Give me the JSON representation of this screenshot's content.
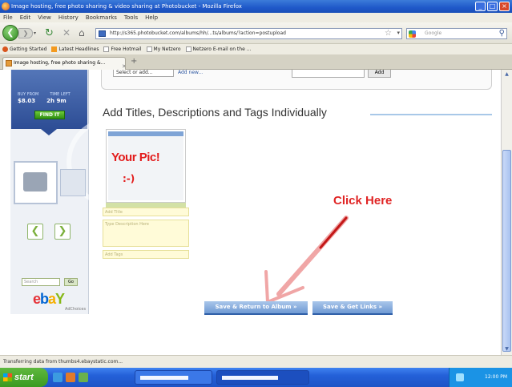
{
  "window": {
    "title": "Image hosting, free photo sharing & video sharing at Photobucket - Mozilla Firefox",
    "controls": {
      "minimize": "_",
      "maximize": "□",
      "close": "×"
    }
  },
  "menu": [
    "File",
    "Edit",
    "View",
    "History",
    "Bookmarks",
    "Tools",
    "Help"
  ],
  "nav": {
    "url": "http://s365.photobucket.com/albums/hh/...ts/albums/?action=postupload",
    "search_placeholder": "Google"
  },
  "bookmarks": [
    {
      "label": "Getting Started",
      "icon": "firefox-icon"
    },
    {
      "label": "Latest Headlines",
      "icon": "rss-icon"
    },
    {
      "label": "Free Hotmail",
      "icon": "page-icon"
    },
    {
      "label": "My Netzero",
      "icon": "page-icon"
    },
    {
      "label": "Netzero E-mail on the ...",
      "icon": "page-icon"
    }
  ],
  "tabs": [
    {
      "label": "Image hosting, free photo sharing &...",
      "active": true
    }
  ],
  "sidebar_ad": {
    "label_buy": "BUY FROM",
    "label_time": "TIME LEFT",
    "price": "$8.03",
    "time_left": "2h 9m",
    "find_it": "FIND IT",
    "search_placeholder": "Search",
    "go": "Go",
    "logo": {
      "e": "e",
      "b": "b",
      "a": "a",
      "y": "Y"
    },
    "adchoices": "AdChoices"
  },
  "form": {
    "event_select": "Select or add...",
    "add_new": "Add new...",
    "add_button": "Add"
  },
  "section": {
    "title": "Add Titles, Descriptions and Tags Individually"
  },
  "photo": {
    "overlay_text": "Your Pic!",
    "overlay_smiley": ":-)",
    "title_placeholder": "Add Title",
    "description_placeholder": "Type Description Here",
    "tags_placeholder": "Add Tags"
  },
  "annotation": {
    "text": "Click Here",
    "color": "#e02424"
  },
  "buttons": {
    "save_return": "Save & Return to Album »",
    "save_links": "Save & Get Links »"
  },
  "status": "Transferring data from thumbs4.ebaystatic.com...",
  "taskbar": {
    "start": "start",
    "clock": "12:00 PM"
  }
}
